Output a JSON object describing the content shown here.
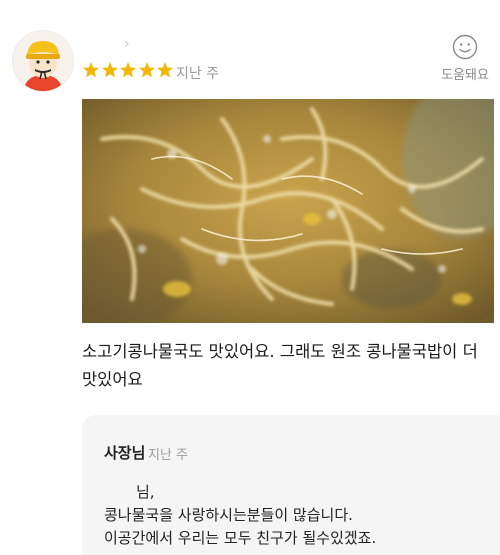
{
  "review": {
    "rating": 5,
    "time": "지난 주",
    "helpful_label": "도움돼요",
    "text": "소고기콩나물국도 맛있어요. 그래도 원조 콩나물국밥이 더 맛있어요"
  },
  "reply": {
    "author": "사장님",
    "time": "지난 주",
    "lines": [
      "님,",
      "콩나물국을 사랑하시는분들이 많습니다.",
      "이공간에서 우리는 모두 친구가 될수있겠죠."
    ]
  },
  "colors": {
    "star": "#f2b705",
    "reply_background": "#f5f5f5",
    "secondary_text": "#9a9a9a"
  },
  "icons": {
    "avatar": "user-avatar-cartoon",
    "helpful": "smile-icon",
    "chevron": "chevron-right-icon",
    "rating": "star-icon"
  }
}
